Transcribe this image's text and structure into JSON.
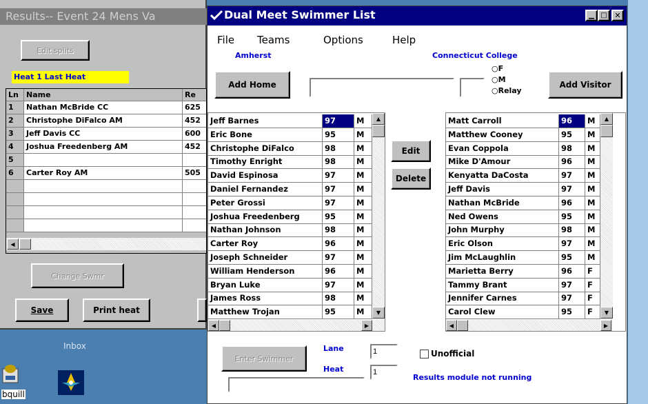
{
  "results_window": {
    "title": "Results-- Event 24 Mens  Va",
    "edit_splits": "Edit splits",
    "heat_label": "Heat 1 Last Heat",
    "headers": [
      "Ln",
      "Name",
      "Re"
    ],
    "rows": [
      {
        "ln": "1",
        "name": "Nathan McBride   CC",
        "re": "625"
      },
      {
        "ln": "2",
        "name": "Christophe DiFalco   AM",
        "re": "452"
      },
      {
        "ln": "3",
        "name": "Jeff Davis   CC",
        "re": "600"
      },
      {
        "ln": "4",
        "name": "Joshua Freedenberg   AM",
        "re": "452"
      },
      {
        "ln": "5",
        "name": "",
        "re": ""
      },
      {
        "ln": "6",
        "name": "Carter Roy   AM",
        "re": "505"
      }
    ],
    "change_swmr": "Change Swmr",
    "save": "Save",
    "print_heat": "Print heat"
  },
  "desktop": {
    "inbox_label": "Inbox",
    "bquill_label": "bquill"
  },
  "dual_meet": {
    "title": "Dual Meet Swimmer List",
    "menu": [
      "File",
      "Teams",
      "Options",
      "Help"
    ],
    "home_team": "Amherst",
    "visitor_team": "Connecticut College",
    "add_home": "Add Home",
    "add_visitor": "Add Visitor",
    "name_input": "",
    "year_input": "",
    "radio_f": "F",
    "radio_m": "M",
    "radio_relay": "Relay",
    "edit": "Edit",
    "delete": "Delete",
    "home_swimmers": [
      {
        "name": "Jeff Barnes",
        "year": "97",
        "sex": "M"
      },
      {
        "name": "Eric Bone",
        "year": "95",
        "sex": "M"
      },
      {
        "name": "Christophe DiFalco",
        "year": "98",
        "sex": "M"
      },
      {
        "name": "Timothy Enright",
        "year": "98",
        "sex": "M"
      },
      {
        "name": "David Espinosa",
        "year": "97",
        "sex": "M"
      },
      {
        "name": "Daniel Fernandez",
        "year": "97",
        "sex": "M"
      },
      {
        "name": "Peter Grossi",
        "year": "97",
        "sex": "M"
      },
      {
        "name": "Joshua Freedenberg",
        "year": "95",
        "sex": "M"
      },
      {
        "name": "Nathan Johnson",
        "year": "98",
        "sex": "M"
      },
      {
        "name": "Carter Roy",
        "year": "96",
        "sex": "M"
      },
      {
        "name": "Joseph Schneider",
        "year": "97",
        "sex": "M"
      },
      {
        "name": "William Henderson",
        "year": "96",
        "sex": "M"
      },
      {
        "name": "Bryan Luke",
        "year": "97",
        "sex": "M"
      },
      {
        "name": "James Ross",
        "year": "98",
        "sex": "M"
      },
      {
        "name": "Matthew Trojan",
        "year": "95",
        "sex": "M"
      }
    ],
    "visitor_swimmers": [
      {
        "name": "Matt Carroll",
        "year": "96",
        "sex": "M"
      },
      {
        "name": "Matthew Cooney",
        "year": "95",
        "sex": "M"
      },
      {
        "name": "Evan Coppola",
        "year": "98",
        "sex": "M"
      },
      {
        "name": "Mike D'Amour",
        "year": "96",
        "sex": "M"
      },
      {
        "name": "Kenyatta DaCosta",
        "year": "97",
        "sex": "M"
      },
      {
        "name": "Jeff Davis",
        "year": "97",
        "sex": "M"
      },
      {
        "name": "Nathan McBride",
        "year": "96",
        "sex": "M"
      },
      {
        "name": "Ned Owens",
        "year": "95",
        "sex": "M"
      },
      {
        "name": "John Murphy",
        "year": "98",
        "sex": "M"
      },
      {
        "name": "Eric Olson",
        "year": "97",
        "sex": "M"
      },
      {
        "name": "Jim McLaughlin",
        "year": "95",
        "sex": "M"
      },
      {
        "name": "Marietta Berry",
        "year": "96",
        "sex": "F"
      },
      {
        "name": "Tammy Brant",
        "year": "97",
        "sex": "F"
      },
      {
        "name": "Jennifer Carnes",
        "year": "97",
        "sex": "F"
      },
      {
        "name": "Carol Clew",
        "year": "95",
        "sex": "F"
      }
    ],
    "enter_swimmer": "Enter Swimmer",
    "lane_label": "Lane",
    "lane_value": "1",
    "heat_label": "Heat",
    "heat_value": "1",
    "unofficial": "Unofficial",
    "status": "Results module not running",
    "bottom_input": ""
  },
  "colors": {
    "titlebar": "#000080",
    "inactive_titlebar": "#808080",
    "highlight_yellow": "#ffff00",
    "blue_text": "#0000d0",
    "selected_year": "#000080"
  }
}
